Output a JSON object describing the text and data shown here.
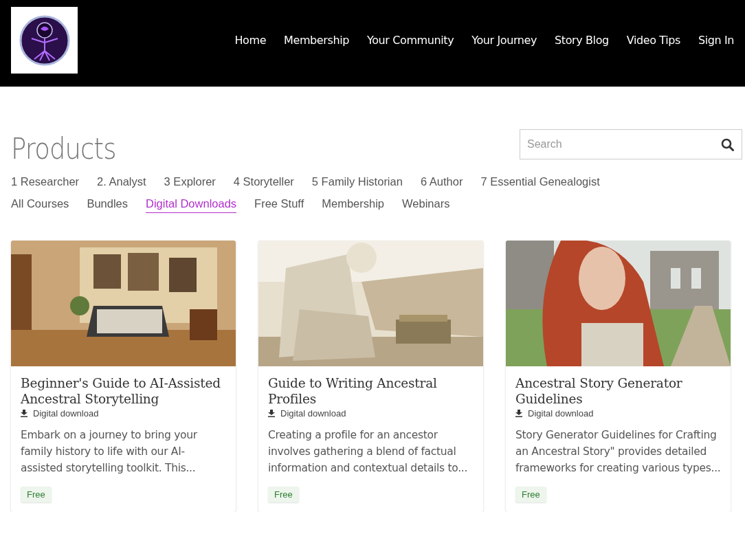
{
  "header": {
    "nav": [
      {
        "label": "Home"
      },
      {
        "label": "Membership"
      },
      {
        "label": "Your Community"
      },
      {
        "label": "Your Journey"
      },
      {
        "label": "Story Blog"
      },
      {
        "label": "Video Tips"
      },
      {
        "label": "Sign In"
      }
    ]
  },
  "page": {
    "title": "Products",
    "search": {
      "placeholder": "Search"
    }
  },
  "category_rows": [
    [
      {
        "label": "1 Researcher",
        "selected": false
      },
      {
        "label": "2. Analyst",
        "selected": false
      },
      {
        "label": "3 Explorer",
        "selected": false
      },
      {
        "label": "4 Storyteller",
        "selected": false
      },
      {
        "label": "5 Family Historian",
        "selected": false
      },
      {
        "label": "6 Author",
        "selected": false
      },
      {
        "label": "7 Essential Genealogist",
        "selected": false
      }
    ],
    [
      {
        "label": "All Courses",
        "selected": false
      },
      {
        "label": "Bundles",
        "selected": false
      },
      {
        "label": "Digital Downloads",
        "selected": true
      },
      {
        "label": "Free Stuff",
        "selected": false
      },
      {
        "label": "Membership",
        "selected": false
      },
      {
        "label": "Webinars",
        "selected": false
      }
    ]
  ],
  "products": [
    {
      "kind": "picture",
      "title": "Beginner's Guide to AI-Assisted Ancestral Storytelling",
      "type": "Digital download",
      "description": "Embark on a journey to bring your family history to life with our AI-assisted storytelling toolkit. This...",
      "price": "Free"
    },
    {
      "kind": "picture",
      "title": "Guide to Writing Ancestral Profiles",
      "type": "Digital download",
      "description": "Creating a profile for an ancestor involves gathering a blend of factual information and contextual details to...",
      "price": "Free"
    },
    {
      "kind": "picture",
      "title": "Ancestral Story Generator Guidelines",
      "type": "Digital download",
      "description": "Story Generator Guidelines for Crafting an Ancestral Story\" provides detailed frameworks for creating various types...",
      "price": "Free"
    }
  ]
}
